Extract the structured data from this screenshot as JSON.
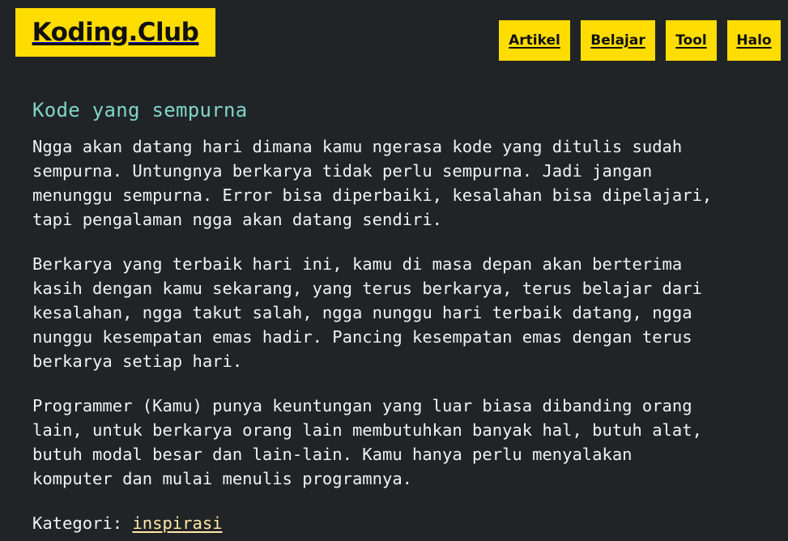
{
  "site": {
    "logo_text": "Koding.Club"
  },
  "nav": {
    "items": [
      {
        "label": "Artikel"
      },
      {
        "label": "Belajar"
      },
      {
        "label": "Tool"
      },
      {
        "label": "Halo"
      }
    ]
  },
  "article": {
    "title": "Kode yang sempurna",
    "paragraphs": [
      {
        "lines": [
          "Ngga akan datang hari dimana kamu ngerasa kode yang ditulis sudah",
          "sempurna. Untungnya berkarya tidak perlu sempurna. Jadi jangan",
          "menunggu sempurna. Error bisa diperbaiki, kesalahan bisa dipelajari,",
          "tapi pengalaman ngga akan datang sendiri."
        ]
      },
      {
        "lines": [
          "Berkarya yang terbaik hari ini, kamu di masa depan akan berterima",
          "kasih dengan kamu sekarang, yang terus berkarya, terus belajar dari",
          "kesalahan, ngga takut salah, ngga nunggu hari terbaik datang, ngga",
          "nunggu kesempatan emas hadir. Pancing kesempatan emas dengan terus",
          "berkarya setiap hari."
        ]
      },
      {
        "lines": [
          "Programmer (Kamu) punya keuntungan yang luar biasa dibanding orang",
          "lain, untuk berkarya orang lain membutuhkan banyak hal, butuh alat,",
          "butuh modal besar dan lain-lain. Kamu hanya perlu menyalakan",
          "komputer dan mulai menulis programnya."
        ]
      }
    ],
    "category_label": "Kategori:",
    "category_link": "inspirasi"
  },
  "colors": {
    "background": "#212426",
    "accent_yellow": "#ffdd00",
    "title_teal": "#7fd6c8",
    "link": "#ffe9a8",
    "text": "#f2f2f2"
  }
}
